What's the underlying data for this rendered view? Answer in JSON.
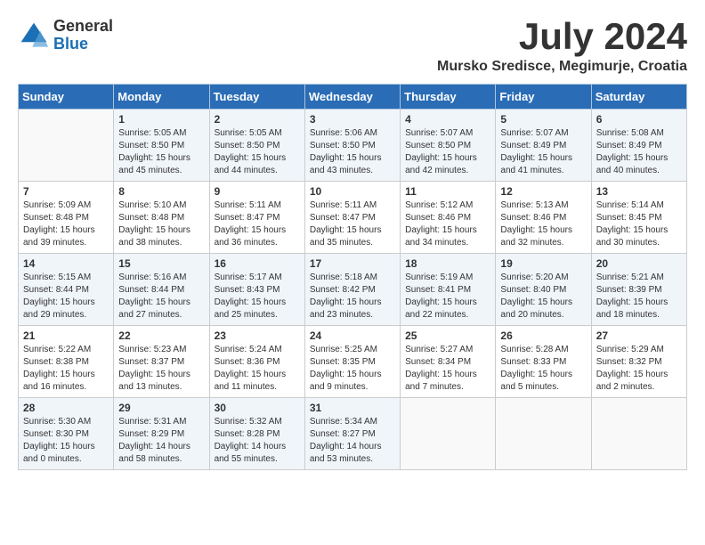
{
  "header": {
    "logo_line1": "General",
    "logo_line2": "Blue",
    "title": "July 2024",
    "subtitle": "Mursko Sredisce, Megimurje, Croatia"
  },
  "weekdays": [
    "Sunday",
    "Monday",
    "Tuesday",
    "Wednesday",
    "Thursday",
    "Friday",
    "Saturday"
  ],
  "weeks": [
    [
      {
        "day": "",
        "content": ""
      },
      {
        "day": "1",
        "content": "Sunrise: 5:05 AM\nSunset: 8:50 PM\nDaylight: 15 hours\nand 45 minutes."
      },
      {
        "day": "2",
        "content": "Sunrise: 5:05 AM\nSunset: 8:50 PM\nDaylight: 15 hours\nand 44 minutes."
      },
      {
        "day": "3",
        "content": "Sunrise: 5:06 AM\nSunset: 8:50 PM\nDaylight: 15 hours\nand 43 minutes."
      },
      {
        "day": "4",
        "content": "Sunrise: 5:07 AM\nSunset: 8:50 PM\nDaylight: 15 hours\nand 42 minutes."
      },
      {
        "day": "5",
        "content": "Sunrise: 5:07 AM\nSunset: 8:49 PM\nDaylight: 15 hours\nand 41 minutes."
      },
      {
        "day": "6",
        "content": "Sunrise: 5:08 AM\nSunset: 8:49 PM\nDaylight: 15 hours\nand 40 minutes."
      }
    ],
    [
      {
        "day": "7",
        "content": "Sunrise: 5:09 AM\nSunset: 8:48 PM\nDaylight: 15 hours\nand 39 minutes."
      },
      {
        "day": "8",
        "content": "Sunrise: 5:10 AM\nSunset: 8:48 PM\nDaylight: 15 hours\nand 38 minutes."
      },
      {
        "day": "9",
        "content": "Sunrise: 5:11 AM\nSunset: 8:47 PM\nDaylight: 15 hours\nand 36 minutes."
      },
      {
        "day": "10",
        "content": "Sunrise: 5:11 AM\nSunset: 8:47 PM\nDaylight: 15 hours\nand 35 minutes."
      },
      {
        "day": "11",
        "content": "Sunrise: 5:12 AM\nSunset: 8:46 PM\nDaylight: 15 hours\nand 34 minutes."
      },
      {
        "day": "12",
        "content": "Sunrise: 5:13 AM\nSunset: 8:46 PM\nDaylight: 15 hours\nand 32 minutes."
      },
      {
        "day": "13",
        "content": "Sunrise: 5:14 AM\nSunset: 8:45 PM\nDaylight: 15 hours\nand 30 minutes."
      }
    ],
    [
      {
        "day": "14",
        "content": "Sunrise: 5:15 AM\nSunset: 8:44 PM\nDaylight: 15 hours\nand 29 minutes."
      },
      {
        "day": "15",
        "content": "Sunrise: 5:16 AM\nSunset: 8:44 PM\nDaylight: 15 hours\nand 27 minutes."
      },
      {
        "day": "16",
        "content": "Sunrise: 5:17 AM\nSunset: 8:43 PM\nDaylight: 15 hours\nand 25 minutes."
      },
      {
        "day": "17",
        "content": "Sunrise: 5:18 AM\nSunset: 8:42 PM\nDaylight: 15 hours\nand 23 minutes."
      },
      {
        "day": "18",
        "content": "Sunrise: 5:19 AM\nSunset: 8:41 PM\nDaylight: 15 hours\nand 22 minutes."
      },
      {
        "day": "19",
        "content": "Sunrise: 5:20 AM\nSunset: 8:40 PM\nDaylight: 15 hours\nand 20 minutes."
      },
      {
        "day": "20",
        "content": "Sunrise: 5:21 AM\nSunset: 8:39 PM\nDaylight: 15 hours\nand 18 minutes."
      }
    ],
    [
      {
        "day": "21",
        "content": "Sunrise: 5:22 AM\nSunset: 8:38 PM\nDaylight: 15 hours\nand 16 minutes."
      },
      {
        "day": "22",
        "content": "Sunrise: 5:23 AM\nSunset: 8:37 PM\nDaylight: 15 hours\nand 13 minutes."
      },
      {
        "day": "23",
        "content": "Sunrise: 5:24 AM\nSunset: 8:36 PM\nDaylight: 15 hours\nand 11 minutes."
      },
      {
        "day": "24",
        "content": "Sunrise: 5:25 AM\nSunset: 8:35 PM\nDaylight: 15 hours\nand 9 minutes."
      },
      {
        "day": "25",
        "content": "Sunrise: 5:27 AM\nSunset: 8:34 PM\nDaylight: 15 hours\nand 7 minutes."
      },
      {
        "day": "26",
        "content": "Sunrise: 5:28 AM\nSunset: 8:33 PM\nDaylight: 15 hours\nand 5 minutes."
      },
      {
        "day": "27",
        "content": "Sunrise: 5:29 AM\nSunset: 8:32 PM\nDaylight: 15 hours\nand 2 minutes."
      }
    ],
    [
      {
        "day": "28",
        "content": "Sunrise: 5:30 AM\nSunset: 8:30 PM\nDaylight: 15 hours\nand 0 minutes."
      },
      {
        "day": "29",
        "content": "Sunrise: 5:31 AM\nSunset: 8:29 PM\nDaylight: 14 hours\nand 58 minutes."
      },
      {
        "day": "30",
        "content": "Sunrise: 5:32 AM\nSunset: 8:28 PM\nDaylight: 14 hours\nand 55 minutes."
      },
      {
        "day": "31",
        "content": "Sunrise: 5:34 AM\nSunset: 8:27 PM\nDaylight: 14 hours\nand 53 minutes."
      },
      {
        "day": "",
        "content": ""
      },
      {
        "day": "",
        "content": ""
      },
      {
        "day": "",
        "content": ""
      }
    ]
  ]
}
